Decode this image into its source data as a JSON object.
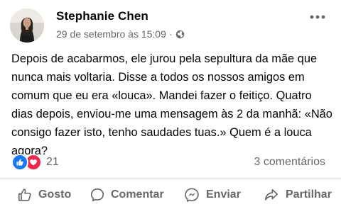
{
  "post": {
    "author": "Stephanie Chen",
    "timestamp": "29 de setembro às 15:09",
    "separator": "·",
    "privacy_icon": "globe-icon",
    "body": "Depois de acabarmos, ele jurou pela sepultura da mãe que nunca mais voltaria. Disse a todos os nossos amigos em comum que eu era «louca». Mandei fazer o feitiço. Quatro dias depois, enviou-me uma mensagem às 2 da manhã: «Não consigo fazer isto, tenho saudades tuas.» Quem é a louca agora?",
    "reactions": {
      "types": [
        "like",
        "love"
      ],
      "count": "21",
      "like_color": "#1877f2",
      "love_color": "#f02849"
    },
    "comments_label": "3 comentários"
  },
  "actions": {
    "like_label": "Gosto",
    "comment_label": "Comentar",
    "send_label": "Enviar",
    "share_label": "Partilhar"
  }
}
